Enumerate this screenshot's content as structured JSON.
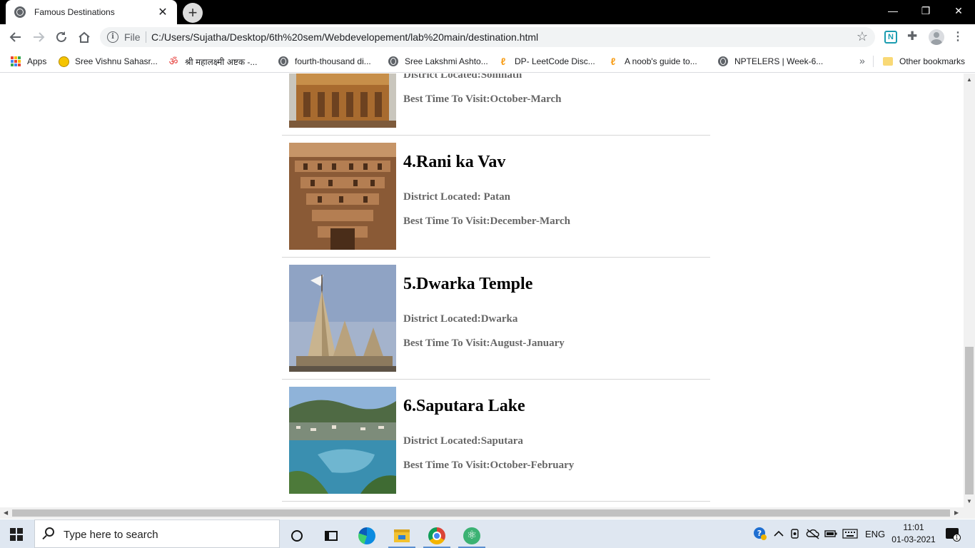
{
  "browser": {
    "tab": {
      "title": "Famous Destinations",
      "close_glyph": "✕"
    },
    "new_tab_glyph": "+",
    "window_controls": {
      "minimize": "—",
      "restore": "❐",
      "close": "✕"
    },
    "address_bar": {
      "scheme_label": "File",
      "url": "C:/Users/Sujatha/Desktop/6th%20sem/Webdevelopement/lab%20main/destination.html"
    },
    "bookmarks": [
      {
        "label": "Apps",
        "icon": "apps-grid-icon"
      },
      {
        "label": "Sree Vishnu Sahasr...",
        "icon": "sun-icon"
      },
      {
        "label": "श्री महालक्ष्मी अष्टक -...",
        "icon": "om-icon"
      },
      {
        "label": "fourth-thousand di...",
        "icon": "globe-icon"
      },
      {
        "label": "Sree Lakshmi Ashto...",
        "icon": "globe-icon"
      },
      {
        "label": "DP- LeetCode Disc...",
        "icon": "leetcode-icon"
      },
      {
        "label": "A noob's guide to...",
        "icon": "leetcode-icon"
      },
      {
        "label": "NPTELERS | Week-6...",
        "icon": "globe-icon"
      }
    ],
    "bookmarks_more_glyph": "»",
    "other_bookmarks": "Other bookmarks"
  },
  "page": {
    "destinations": [
      {
        "name": "",
        "district": "District Located:Somnath",
        "best_time": "Best Time To Visit:October-March"
      },
      {
        "name": "4.Rani ka Vav",
        "district": "District Located: Patan",
        "best_time": "Best Time To Visit:December-March"
      },
      {
        "name": "5.Dwarka Temple",
        "district": "District Located:Dwarka",
        "best_time": "Best Time To Visit:August-January"
      },
      {
        "name": "6.Saputara Lake",
        "district": "District Located:Saputara",
        "best_time": "Best Time To Visit:October-February"
      }
    ]
  },
  "taskbar": {
    "search_placeholder": "Type here to search",
    "language": "ENG",
    "time": "11:01",
    "date": "01-03-2021",
    "notification_count": "1"
  },
  "colors": {
    "heading": "#000000",
    "detail_text": "#666666",
    "taskbar_bg": "#dfe7f1"
  }
}
